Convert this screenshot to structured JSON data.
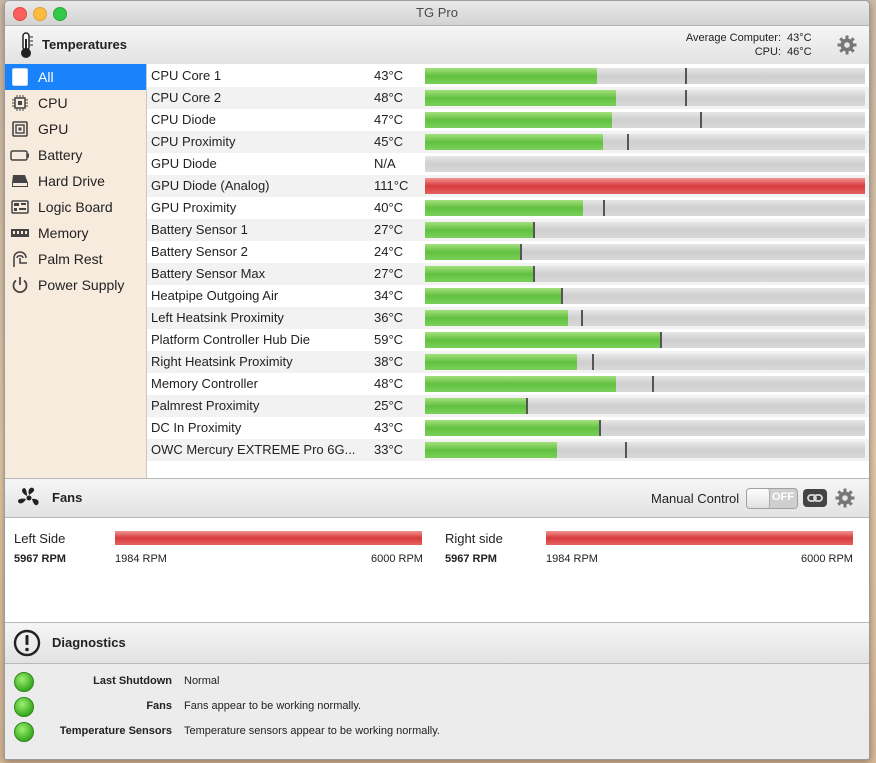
{
  "window": {
    "title": "TG Pro"
  },
  "temperatures": {
    "title": "Temperatures",
    "average_label": "Average Computer:",
    "average_value": "43°C",
    "cpu_label": "CPU:",
    "cpu_value": "46°C"
  },
  "sidebar": {
    "items": [
      {
        "label": "All",
        "icon": "monitor-icon"
      },
      {
        "label": "CPU",
        "icon": "cpu-chip-icon"
      },
      {
        "label": "GPU",
        "icon": "gpu-chip-icon"
      },
      {
        "label": "Battery",
        "icon": "battery-icon"
      },
      {
        "label": "Hard Drive",
        "icon": "hard-drive-icon"
      },
      {
        "label": "Logic Board",
        "icon": "logic-board-icon"
      },
      {
        "label": "Memory",
        "icon": "memory-icon"
      },
      {
        "label": "Palm Rest",
        "icon": "palm-rest-icon"
      },
      {
        "label": "Power Supply",
        "icon": "power-icon"
      }
    ]
  },
  "sensors": [
    {
      "name": "CPU Core 1",
      "temp": "43°C",
      "level": 0.39,
      "max": 0.59,
      "hot": false
    },
    {
      "name": "CPU Core 2",
      "temp": "48°C",
      "level": 0.435,
      "max": 0.59,
      "hot": false
    },
    {
      "name": "CPU Diode",
      "temp": "47°C",
      "level": 0.425,
      "max": 0.625,
      "hot": false
    },
    {
      "name": "CPU Proximity",
      "temp": "45°C",
      "level": 0.405,
      "max": 0.458,
      "hot": false
    },
    {
      "name": "GPU Diode",
      "temp": "N/A",
      "level": 0,
      "max": null,
      "hot": false
    },
    {
      "name": "GPU Diode (Analog)",
      "temp": "111°C",
      "level": 1.0,
      "max": null,
      "hot": true
    },
    {
      "name": "GPU Proximity",
      "temp": "40°C",
      "level": 0.36,
      "max": 0.405,
      "hot": false
    },
    {
      "name": "Battery Sensor 1",
      "temp": "27°C",
      "level": 0.245,
      "max": 0.245,
      "hot": false
    },
    {
      "name": "Battery Sensor 2",
      "temp": "24°C",
      "level": 0.215,
      "max": 0.215,
      "hot": false
    },
    {
      "name": "Battery Sensor Max",
      "temp": "27°C",
      "level": 0.245,
      "max": 0.245,
      "hot": false
    },
    {
      "name": "Heatpipe Outgoing Air",
      "temp": "34°C",
      "level": 0.31,
      "max": 0.31,
      "hot": false
    },
    {
      "name": "Left Heatsink Proximity",
      "temp": "36°C",
      "level": 0.325,
      "max": 0.355,
      "hot": false
    },
    {
      "name": "Platform Controller Hub Die",
      "temp": "59°C",
      "level": 0.535,
      "max": 0.535,
      "hot": false
    },
    {
      "name": "Right Heatsink Proximity",
      "temp": "38°C",
      "level": 0.345,
      "max": 0.38,
      "hot": false
    },
    {
      "name": "Memory Controller",
      "temp": "48°C",
      "level": 0.435,
      "max": 0.515,
      "hot": false
    },
    {
      "name": "Palmrest Proximity",
      "temp": "25°C",
      "level": 0.23,
      "max": 0.23,
      "hot": false
    },
    {
      "name": "DC In Proximity",
      "temp": "43°C",
      "level": 0.395,
      "max": 0.395,
      "hot": false
    },
    {
      "name": "OWC Mercury EXTREME Pro 6G...",
      "temp": "33°C",
      "level": 0.3,
      "max": 0.455,
      "hot": false
    }
  ],
  "fans": {
    "title": "Fans",
    "manual_control_label": "Manual Control",
    "toggle_state": "OFF",
    "items": [
      {
        "name": "Left Side",
        "rpm": "5967 RPM",
        "min": "1984 RPM",
        "max": "6000 RPM",
        "level": 0.99
      },
      {
        "name": "Right side",
        "rpm": "5967 RPM",
        "min": "1984 RPM",
        "max": "6000 RPM",
        "level": 0.99
      }
    ]
  },
  "diagnostics": {
    "title": "Diagnostics",
    "rows": [
      {
        "label": "Last Shutdown",
        "value": "Normal"
      },
      {
        "label": "Fans",
        "value": "Fans appear to be working normally."
      },
      {
        "label": "Temperature Sensors",
        "value": "Temperature sensors appear to be working normally."
      }
    ]
  },
  "colors": {
    "selection": "#1a82fb",
    "bar_green": "#62c040",
    "bar_red": "#d83b3b",
    "status_green": "#3aab22"
  }
}
